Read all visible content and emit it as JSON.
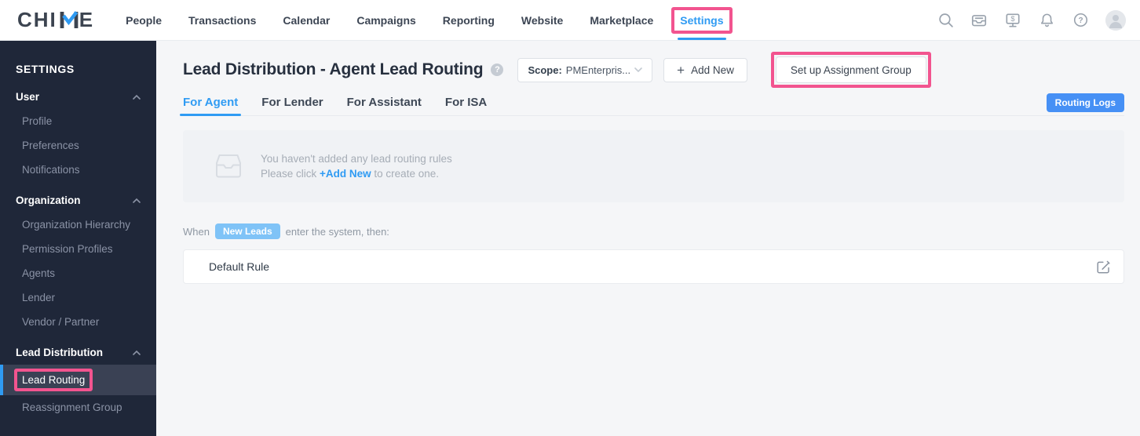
{
  "brand": {
    "name_left": "CHI",
    "name_right": "E",
    "logo_accent": "#2f9bf3"
  },
  "topnav": {
    "items": [
      "People",
      "Transactions",
      "Calendar",
      "Campaigns",
      "Reporting",
      "Website",
      "Marketplace",
      "Settings"
    ],
    "active_item": "Settings",
    "icons": [
      "search-icon",
      "inbox-icon",
      "billing-monitor-icon",
      "notifications-bell-icon",
      "help-icon",
      "user-avatar"
    ]
  },
  "sidebar": {
    "header": "SETTINGS",
    "sections": [
      {
        "label": "User",
        "items": [
          "Profile",
          "Preferences",
          "Notifications"
        ]
      },
      {
        "label": "Organization",
        "items": [
          "Organization Hierarchy",
          "Permission Profiles",
          "Agents",
          "Lender",
          "Vendor / Partner"
        ]
      },
      {
        "label": "Lead Distribution",
        "items": [
          "Lead Routing",
          "Reassignment Group"
        ],
        "active_item": "Lead Routing"
      }
    ]
  },
  "main": {
    "title": "Lead Distribution - Agent Lead Routing",
    "scope": {
      "label": "Scope:",
      "value": "PMEnterpris..."
    },
    "buttons": {
      "add_new": "Add New",
      "set_up_assignment_group": "Set up Assignment Group",
      "routing_logs": "Routing Logs"
    },
    "tabs": [
      "For Agent",
      "For Lender",
      "For Assistant",
      "For ISA"
    ],
    "active_tab": "For Agent",
    "empty_state": {
      "line1": "You haven't added any lead routing rules",
      "line2_prefix": "Please click ",
      "line2_link": "+Add New",
      "line2_suffix": " to create one."
    },
    "when_rule": {
      "prefix": "When",
      "badge": "New Leads",
      "suffix": "enter the system, then:"
    },
    "rules": [
      {
        "name": "Default Rule"
      }
    ]
  },
  "glyphs": {
    "plus": "+",
    "question": "?"
  },
  "annotations": {
    "highlight_color": "#f2548f",
    "highlighted": [
      "Settings nav item",
      "Set up Assignment Group button",
      "Lead Routing sidebar item"
    ]
  },
  "colors": {
    "accent_blue": "#2f9bf3",
    "sidebar_bg": "#1f2739",
    "sidebar_active_bg": "#3a4154",
    "badge_blue": "#7fc3f7",
    "routing_logs_bg": "#4690f5",
    "highlight_pink": "#f2548f"
  }
}
